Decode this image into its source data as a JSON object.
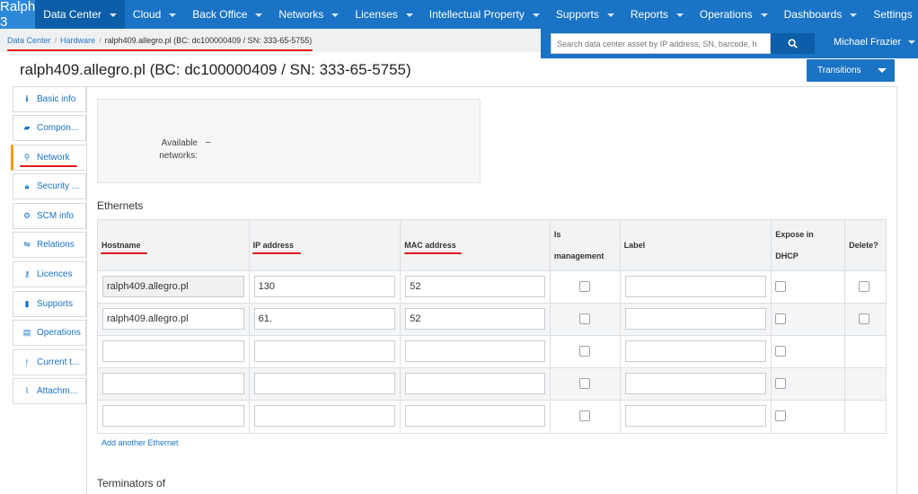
{
  "app": {
    "brand": "Ralph 3"
  },
  "nav": {
    "items": [
      {
        "label": "Data Center",
        "active": true
      },
      {
        "label": "Cloud"
      },
      {
        "label": "Back Office"
      },
      {
        "label": "Networks"
      },
      {
        "label": "Licenses"
      },
      {
        "label": "Intellectual Property"
      },
      {
        "label": "Supports"
      },
      {
        "label": "Reports"
      },
      {
        "label": "Operations"
      },
      {
        "label": "Dashboards"
      },
      {
        "label": "Settings"
      }
    ]
  },
  "breadcrumb": {
    "items": [
      "Data Center",
      "Hardware"
    ],
    "current": "ralph409.allegro.pl (BC: dc100000409 / SN: 333-65-5755)"
  },
  "search": {
    "placeholder": "Search data center asset by IP address, SN, barcode, h"
  },
  "user": {
    "name": "Michael Frazier"
  },
  "page": {
    "title": "ralph409.allegro.pl (BC: dc100000409 / SN: 333-65-5755)",
    "transitions_label": "Transitions"
  },
  "sidetabs": [
    {
      "label": "Basic info",
      "icon": "info-icon"
    },
    {
      "label": "Compon...",
      "icon": "folder-icon"
    },
    {
      "label": "Network",
      "icon": "link-icon",
      "active": true
    },
    {
      "label": "Security ...",
      "icon": "lock-icon"
    },
    {
      "label": "SCM info",
      "icon": "gears-icon"
    },
    {
      "label": "Relations",
      "icon": "relations-icon"
    },
    {
      "label": "Licences",
      "icon": "key-icon"
    },
    {
      "label": "Supports",
      "icon": "bookmark-icon"
    },
    {
      "label": "Operations",
      "icon": "document-icon"
    },
    {
      "label": "Current t...",
      "icon": "branch-icon"
    },
    {
      "label": "Attachm...",
      "icon": "paperclip-icon"
    }
  ],
  "network": {
    "available_label": "Available networks:",
    "available_value": "–",
    "ethernets_title": "Ethernets",
    "headers": {
      "hostname": "Hostname",
      "ip": "IP address",
      "mac": "MAC address",
      "is_management_1": "Is",
      "is_management_2": "management",
      "label": "Label",
      "expose_1": "Expose in",
      "expose_2": "DHCP",
      "delete": "Delete?"
    },
    "rows": [
      {
        "hostname": "ralph409.allegro.pl",
        "ip": "130",
        "mac": "52",
        "label": ""
      },
      {
        "hostname": "ralph409.allegro.pl",
        "ip": "61.",
        "mac": "52",
        "label": ""
      },
      {
        "hostname": "",
        "ip": "",
        "mac": "",
        "label": ""
      },
      {
        "hostname": "",
        "ip": "",
        "mac": "",
        "label": ""
      },
      {
        "hostname": "",
        "ip": "",
        "mac": "",
        "label": ""
      }
    ],
    "add_link": "Add another Ethernet",
    "terminators_title": "Terminators of"
  },
  "colors": {
    "nav_bg": "#1a73c4",
    "active_tab_accent": "#f39c12",
    "annotation_red": "#e01c1c"
  }
}
